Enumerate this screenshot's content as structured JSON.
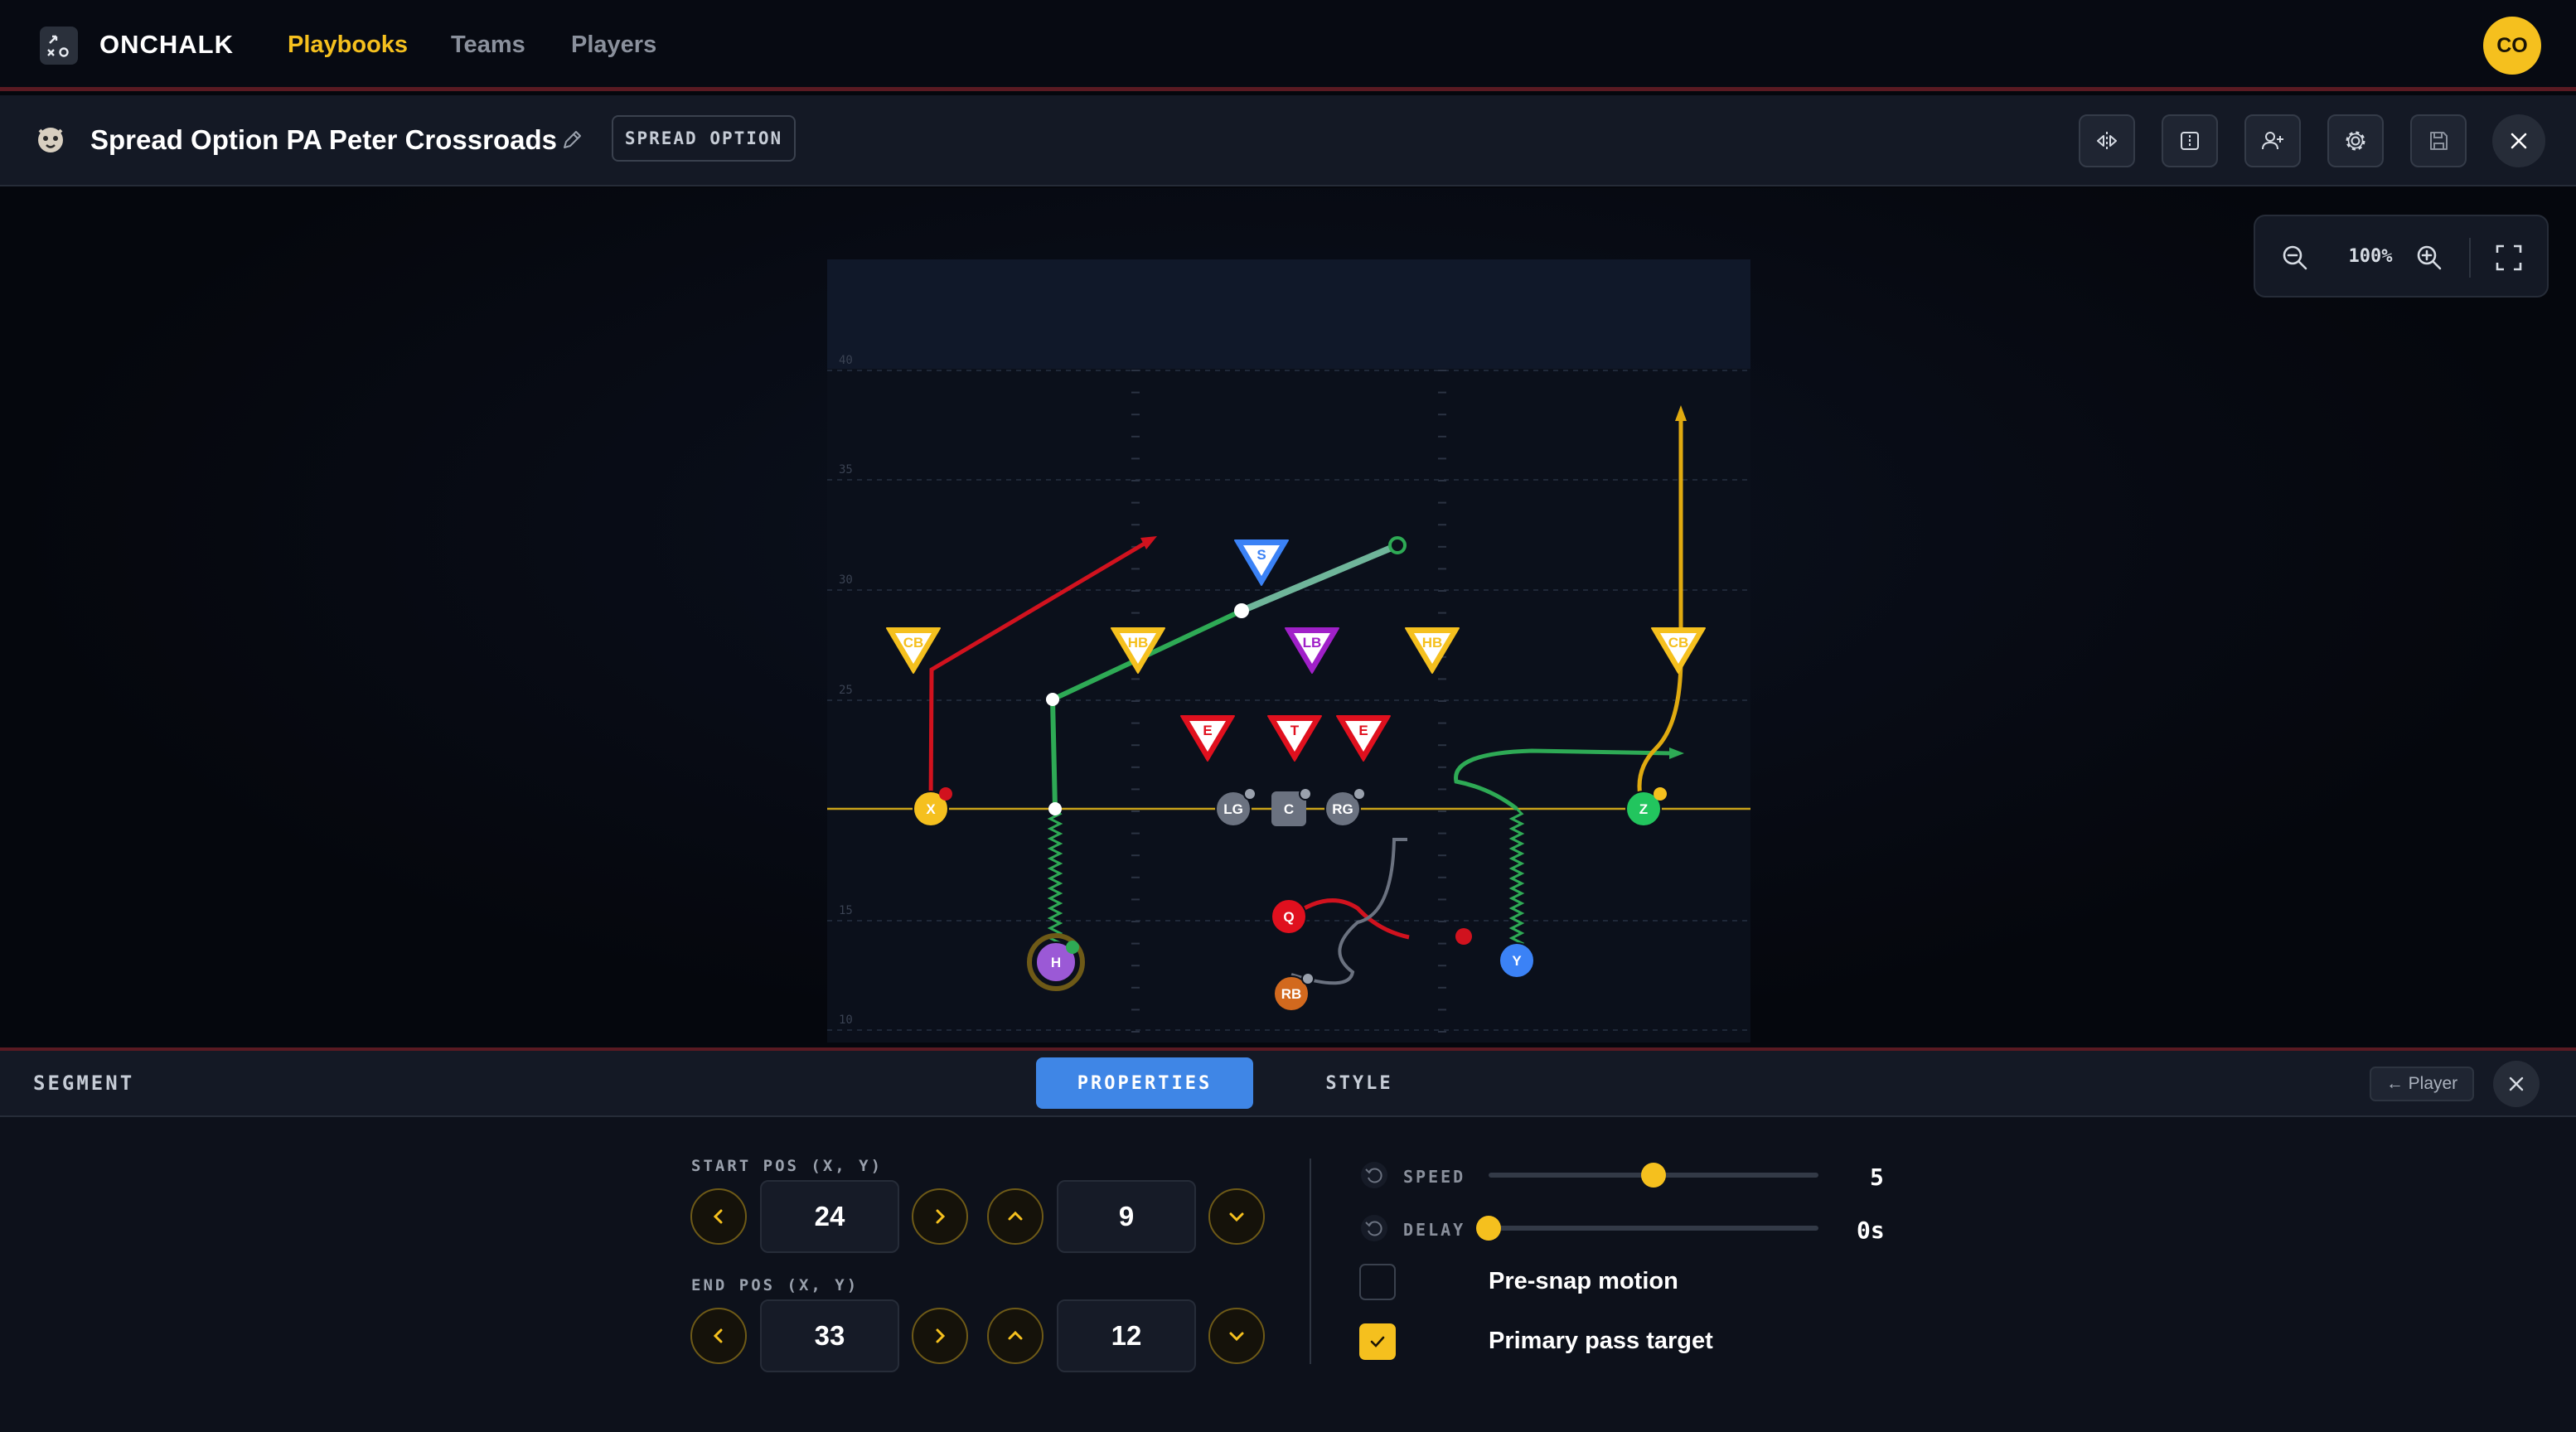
{
  "app": {
    "brand": "ONCHALK",
    "nav": [
      {
        "label": "Playbooks",
        "active": true
      },
      {
        "label": "Teams",
        "active": false
      },
      {
        "label": "Players",
        "active": false
      }
    ],
    "user_initials": "CO",
    "accent_color": "#f5c01e"
  },
  "play": {
    "title": "Spread Option PA Peter Crossroads",
    "formation": "SPREAD OPTION",
    "toolbar_icons": [
      "flip-horizontal-icon",
      "split-view-icon",
      "add-player-icon",
      "gear-icon",
      "save-icon",
      "close-icon"
    ]
  },
  "canvas": {
    "zoom": "100%",
    "yard_lines": [
      "40",
      "35",
      "30",
      "25",
      "15",
      "10"
    ],
    "offense": [
      {
        "label": "X",
        "color": "#f5c01e"
      },
      {
        "label": "H",
        "color": "#9b59d6"
      },
      {
        "label": "LG",
        "color": "#6b7280"
      },
      {
        "label": "C",
        "color": "#6b7280"
      },
      {
        "label": "RG",
        "color": "#6b7280"
      },
      {
        "label": "Q",
        "color": "#e0101e"
      },
      {
        "label": "RB",
        "color": "#d2691e"
      },
      {
        "label": "Y",
        "color": "#3b82f6"
      },
      {
        "label": "Z",
        "color": "#22c55e"
      }
    ],
    "defense": [
      {
        "label": "CB",
        "color": "#f5c01e"
      },
      {
        "label": "HB",
        "color": "#f5c01e"
      },
      {
        "label": "S",
        "color": "#3b82f6"
      },
      {
        "label": "LB",
        "color": "#a020c8"
      },
      {
        "label": "HB",
        "color": "#f5c01e"
      },
      {
        "label": "CB",
        "color": "#f5c01e"
      },
      {
        "label": "E",
        "color": "#e0101e"
      },
      {
        "label": "T",
        "color": "#e0101e"
      },
      {
        "label": "E",
        "color": "#e0101e"
      }
    ]
  },
  "panel": {
    "title": "SEGMENT",
    "tabs": [
      {
        "label": "PROPERTIES",
        "active": true
      },
      {
        "label": "STYLE",
        "active": false
      }
    ],
    "back_label": "← Player",
    "start_pos": {
      "label": "START POS (X, Y)",
      "x": "24",
      "y": "9"
    },
    "end_pos": {
      "label": "END POS (X, Y)",
      "x": "33",
      "y": "12"
    },
    "speed": {
      "label": "SPEED",
      "value": "5",
      "fraction": 0.5
    },
    "delay": {
      "label": "DELAY",
      "value": "0s",
      "fraction": 0.0
    },
    "pre_snap_motion": {
      "label": "Pre-snap motion",
      "checked": false
    },
    "primary_pass_target": {
      "label": "Primary pass target",
      "checked": true
    }
  }
}
